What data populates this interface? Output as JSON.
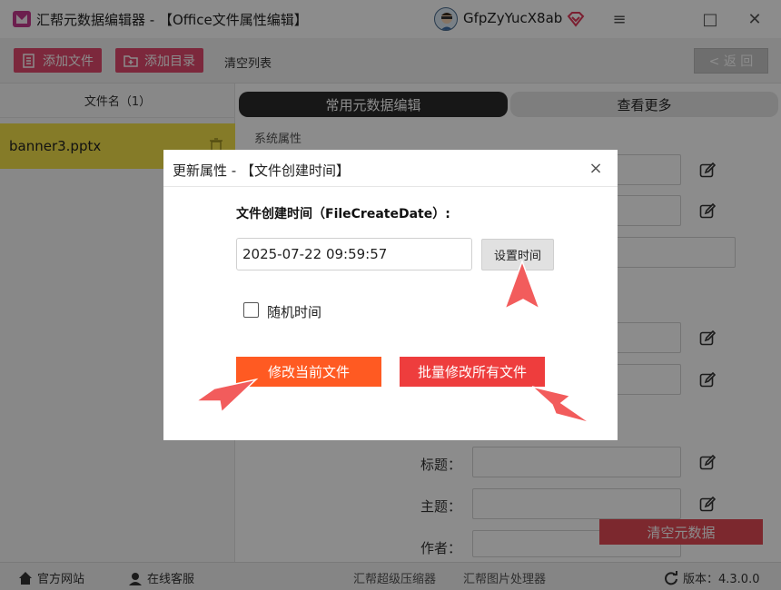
{
  "window": {
    "title": "汇帮元数据编辑器 - 【Office文件属性编辑】",
    "username": "GfpZyYucX8ab",
    "controls": {
      "menu": "≡",
      "maximize": "□",
      "close": "✕"
    }
  },
  "toolbar": {
    "add_file": "添加文件",
    "add_folder": "添加目录",
    "clear_list": "清空列表",
    "back": "< 返 回"
  },
  "file_list": {
    "header": "文件名（1）",
    "files": [
      "banner3.pptx"
    ]
  },
  "tabs": {
    "active": "常用元数据编辑",
    "more": "查看更多"
  },
  "properties": {
    "section": "系统属性",
    "labels": {
      "title": "标题：",
      "subject": "主题：",
      "author": "作者："
    },
    "clear_metadata": "清空元数据"
  },
  "statusbar": {
    "website": "官方网站",
    "support": "在线客服",
    "compressor": "汇帮超级压缩器",
    "image_tool": "汇帮图片处理器",
    "version": "版本：4.3.0.0"
  },
  "dialog": {
    "title": "更新属性 - 【文件创建时间】",
    "close": "×",
    "field_label": "文件创建时间（FileCreateDate）:",
    "date_value": "2025-07-22 09:59:57",
    "set_time": "设置时间",
    "random_time": "随机时间",
    "modify_current": "修改当前文件",
    "batch_modify": "批量修改所有文件"
  },
  "colors": {
    "accent_pink": "#e24a6d",
    "highlight_yellow": "#f2e14a",
    "arrow": "#f25c5c",
    "btn_orange": "#ff5a22",
    "btn_red": "#ee3d3d"
  }
}
